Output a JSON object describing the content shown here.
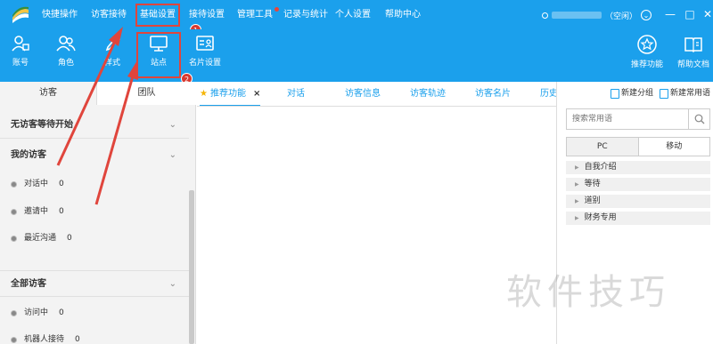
{
  "topbar": {
    "menu": [
      {
        "label": "快捷操作"
      },
      {
        "label": "访客接待"
      },
      {
        "label": "基础设置"
      },
      {
        "label": "接待设置"
      },
      {
        "label": "管理工具"
      },
      {
        "label": "记录与统计"
      },
      {
        "label": "个人设置"
      },
      {
        "label": "帮助中心"
      }
    ],
    "status_text": "（空闲）"
  },
  "toolbar": {
    "items": [
      {
        "label": "账号",
        "icon": "account-icon"
      },
      {
        "label": "角色",
        "icon": "role-icon"
      },
      {
        "label": "样式",
        "icon": "style-icon"
      },
      {
        "label": "站点",
        "icon": "site-icon"
      },
      {
        "label": "名片设置",
        "icon": "card-settings-icon"
      }
    ],
    "right_items": [
      {
        "label": "推荐功能",
        "icon": "recommend-icon"
      },
      {
        "label": "帮助文档",
        "icon": "help-doc-icon"
      }
    ]
  },
  "annotations": {
    "badge1": "1",
    "badge2": "2"
  },
  "sidebar": {
    "tabs": [
      "访客",
      "团队"
    ],
    "sections": [
      {
        "title": "无访客等待开始"
      },
      {
        "title": "我的访客",
        "items": [
          {
            "label": "对话中",
            "count": "0"
          },
          {
            "label": "邀请中",
            "count": "0"
          },
          {
            "label": "最近沟通",
            "count": "0"
          }
        ]
      },
      {
        "title": "全部访客",
        "items": [
          {
            "label": "访问中",
            "count": "0"
          },
          {
            "label": "机器人接待",
            "count": "0"
          }
        ]
      }
    ]
  },
  "content_tabs": [
    "推荐功能",
    "对话",
    "访客信息",
    "访客轨迹",
    "访客名片",
    "历史"
  ],
  "right_panel": {
    "new_group": "新建分组",
    "new_phrase": "新建常用语",
    "search_placeholder": "搜索常用语",
    "segments": [
      "PC",
      "移动"
    ],
    "categories": [
      "自我介绍",
      "等待",
      "道别",
      "财务专用"
    ]
  },
  "watermark": "软件技巧",
  "colors": {
    "accent": "#1ba0ec",
    "annotation": "#e0453c"
  }
}
